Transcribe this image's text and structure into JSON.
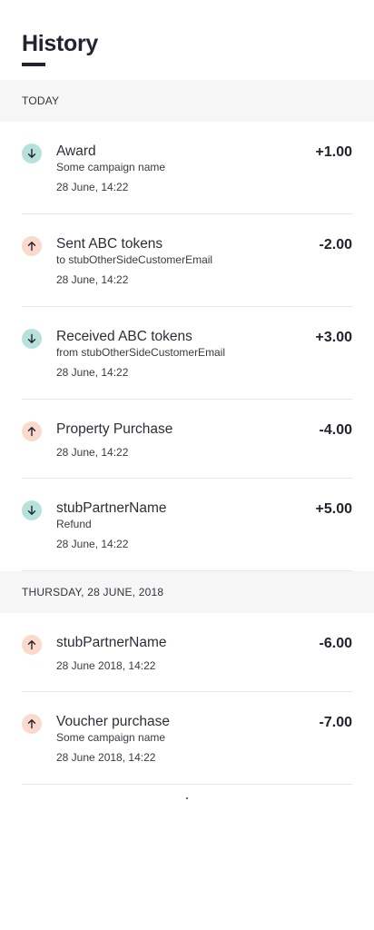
{
  "page": {
    "title": "History"
  },
  "sections": [
    {
      "label": "TODAY",
      "items": [
        {
          "direction": "in",
          "title": "Award",
          "subtitle": "Some campaign name",
          "date": "28 June, 14:22",
          "amount": "+1.00"
        },
        {
          "direction": "out",
          "title": "Sent ABC tokens",
          "subtitle": "to stubOtherSideCustomerEmail",
          "date": "28 June, 14:22",
          "amount": "-2.00"
        },
        {
          "direction": "in",
          "title": "Received ABC tokens",
          "subtitle": "from stubOtherSideCustomerEmail",
          "date": "28 June, 14:22",
          "amount": "+3.00"
        },
        {
          "direction": "out",
          "title": "Property Purchase",
          "subtitle": "",
          "date": "28 June, 14:22",
          "amount": "-4.00"
        },
        {
          "direction": "in",
          "title": "stubPartnerName",
          "subtitle": "Refund",
          "date": "28 June, 14:22",
          "amount": "+5.00"
        }
      ]
    },
    {
      "label": "THURSDAY, 28 JUNE, 2018",
      "items": [
        {
          "direction": "out",
          "title": "stubPartnerName",
          "subtitle": "",
          "date": "28 June 2018, 14:22",
          "amount": "-6.00"
        },
        {
          "direction": "out",
          "title": "Voucher purchase",
          "subtitle": "Some campaign name",
          "date": "28 June 2018, 14:22",
          "amount": "-7.00"
        }
      ]
    }
  ],
  "icons": {
    "in": "arrow-down-icon",
    "out": "arrow-up-icon"
  },
  "colors": {
    "in_bg": "#b7e2dc",
    "out_bg": "#fbd9cc",
    "text": "#23232f",
    "section_bg": "#f6f6f6"
  }
}
